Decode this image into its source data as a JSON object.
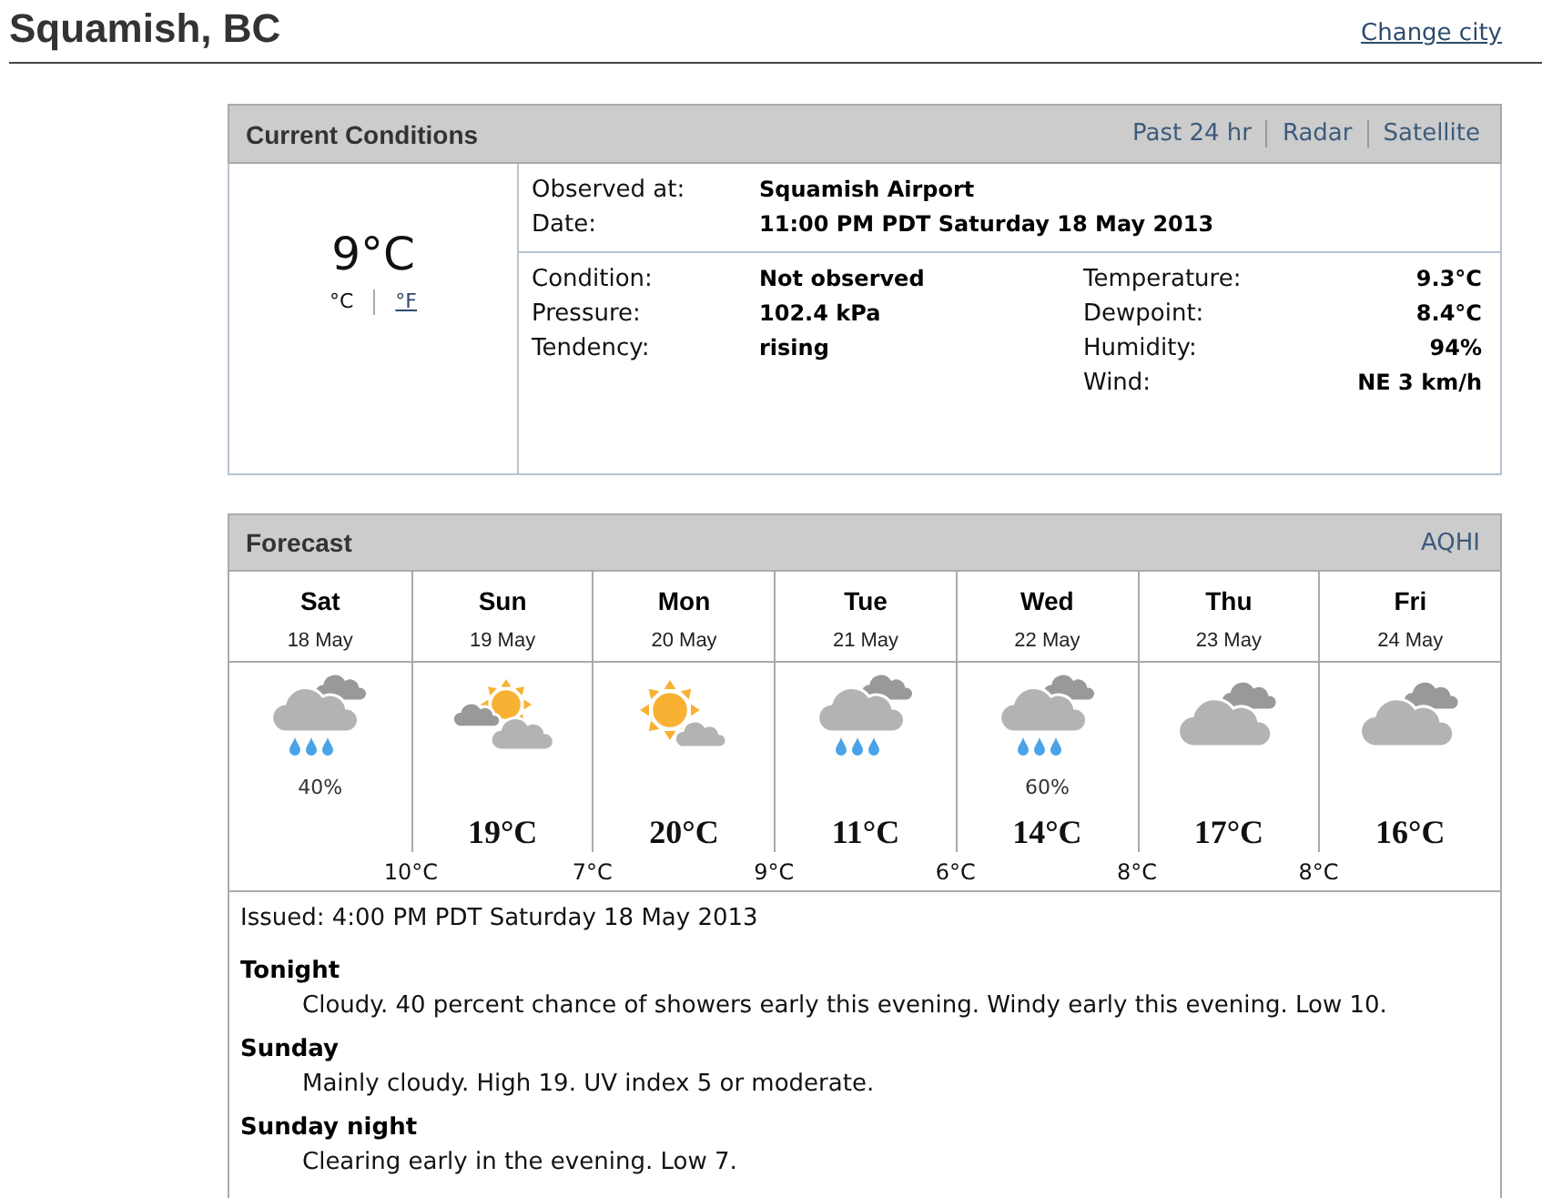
{
  "header": {
    "city": "Squamish, BC",
    "change_city": "Change city"
  },
  "current_conditions": {
    "title": "Current Conditions",
    "links": [
      "Past 24 hr",
      "Radar",
      "Satellite"
    ],
    "temperature": "9°C",
    "units": [
      {
        "label": "°C",
        "selected": true
      },
      {
        "label": "°F",
        "selected": false
      }
    ],
    "observation": [
      {
        "label": "Observed at:",
        "value": "Squamish Airport"
      },
      {
        "label": "Date:",
        "value": "11:00 PM PDT Saturday 18 May 2013"
      }
    ],
    "conditions": [
      {
        "label": "Condition:",
        "value": "Not observed"
      },
      {
        "label": "Pressure:",
        "value": "102.4 kPa"
      },
      {
        "label": "Tendency:",
        "value": "rising"
      }
    ],
    "measurements": [
      {
        "label": "Temperature:",
        "value": "9.3°C"
      },
      {
        "label": "Dewpoint:",
        "value": "8.4°C"
      },
      {
        "label": "Humidity:",
        "value": "94%"
      },
      {
        "label": "Wind:",
        "value": "NE 3 km/h"
      }
    ]
  },
  "forecast": {
    "title": "Forecast",
    "links": [
      "AQHI"
    ],
    "days": [
      {
        "day": "Sat",
        "date": "18 May",
        "kind": "showers",
        "pop": "40%",
        "low": "10°C"
      },
      {
        "day": "Sun",
        "date": "19 May",
        "kind": "sun-and-clouds",
        "high": "19°C",
        "low": "7°C"
      },
      {
        "day": "Mon",
        "date": "20 May",
        "kind": "sun-and-cloud",
        "high": "20°C",
        "low": "9°C"
      },
      {
        "day": "Tue",
        "date": "21 May",
        "kind": "showers",
        "high": "11°C",
        "low": "6°C"
      },
      {
        "day": "Wed",
        "date": "22 May",
        "kind": "showers",
        "pop": "60%",
        "high": "14°C",
        "low": "8°C"
      },
      {
        "day": "Thu",
        "date": "23 May",
        "kind": "cloudy",
        "high": "17°C",
        "low": "8°C"
      },
      {
        "day": "Fri",
        "date": "24 May",
        "kind": "cloudy",
        "high": "16°C"
      }
    ],
    "issued": "Issued: 4:00 PM PDT Saturday 18 May 2013",
    "periods": [
      {
        "name": "Tonight",
        "text": "Cloudy. 40 percent chance of showers early this evening. Windy early this evening. Low 10."
      },
      {
        "name": "Sunday",
        "text": "Mainly cloudy. High 19. UV index 5 or moderate."
      },
      {
        "name": "Sunday night",
        "text": "Clearing early in the evening. Low 7."
      }
    ]
  }
}
